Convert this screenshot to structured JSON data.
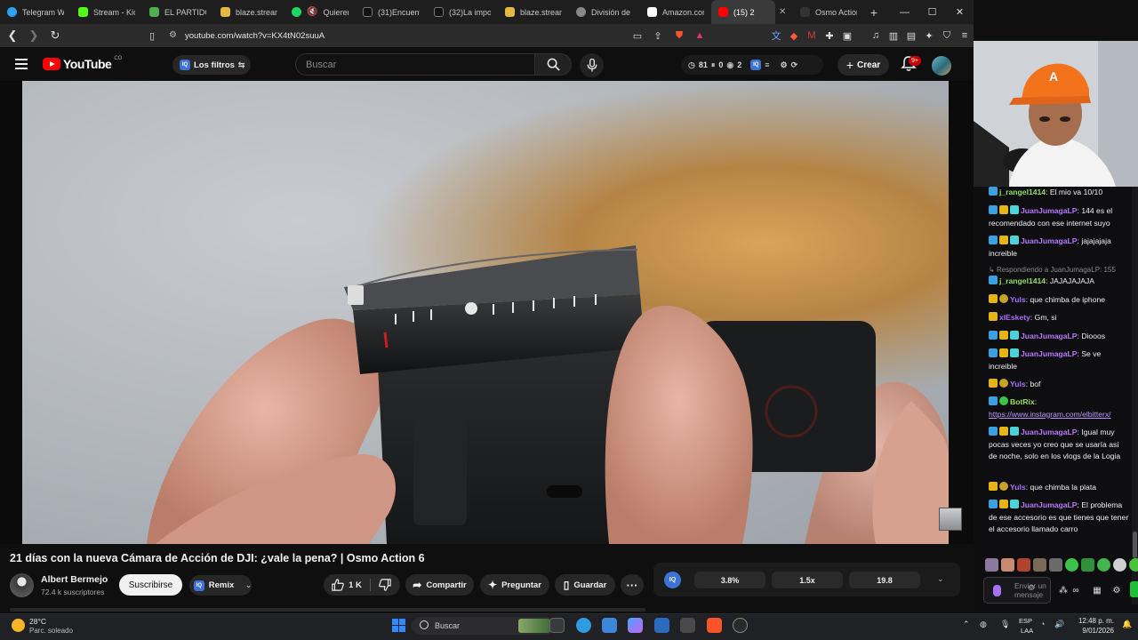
{
  "browser": {
    "tabs": [
      {
        "label": "Telegram We",
        "color": "#2aa3ef"
      },
      {
        "label": "Stream - Kick",
        "color": "#53fc18"
      },
      {
        "label": "EL PARTIDO",
        "color": "#4caf50"
      },
      {
        "label": "blaze.stream",
        "color": "#e5b93c"
      },
      {
        "label": "Quieren",
        "color": "#1ed760"
      },
      {
        "label": "(31)Encuent",
        "color": "#ffffff"
      },
      {
        "label": "(32)La impor",
        "color": "#ffffff"
      },
      {
        "label": "blaze.stream",
        "color": "#e5b93c"
      },
      {
        "label": "División de n",
        "color": "#cccccc"
      },
      {
        "label": "Amazon.com",
        "color": "#ffffff"
      },
      {
        "label": "(15) 2",
        "color": "#ff0000"
      },
      {
        "label": "Osmo Action",
        "color": "#333333"
      }
    ],
    "url": "youtube.com/watch?v=KX4tN02suuA"
  },
  "youtube": {
    "logo_text": "YouTube",
    "country_code": "CO",
    "filters_label": "Los filtros",
    "iq": "IQ",
    "search_placeholder": "Buscar",
    "stats": {
      "a": "81",
      "b": "0",
      "c": "2"
    },
    "create_label": "Crear",
    "notif_count": "9+"
  },
  "video": {
    "title": "21 días con la nueva Cámara de Acción de DJI: ¿vale la pena? | Osmo Action 6",
    "channel": "Albert Bermejo",
    "subscribers": "72.4 k suscriptores",
    "subscribe_label": "Suscribirse",
    "remix_label": "Remix",
    "likes": "1 K",
    "share_label": "Compartir",
    "ask_label": "Preguntar",
    "save_label": "Guardar",
    "more_label": "···"
  },
  "extension": {
    "logo": "IQ",
    "stats": [
      "3.8%",
      "1.5x",
      "19.8"
    ]
  },
  "chat": {
    "messages": [
      {
        "user": "j_rangel1414",
        "text": "El mio va 10/10"
      },
      {
        "user": "JuanJumagaLP",
        "text": "144 es el recomendado con ese internet suyo"
      },
      {
        "user": "JuanJumagaLP",
        "text": "jajajajaja increible"
      },
      {
        "reply": "Respondiendo a JuanJumagaLP: 155"
      },
      {
        "user": "j_rangel1414",
        "text": "JAJAJAJAJA"
      },
      {
        "user": "Yuls",
        "text": "que chimba de iphone"
      },
      {
        "user": "xIEskety",
        "text": "Gm, si"
      },
      {
        "user": "JuanJumagaLP",
        "text": "Diooos"
      },
      {
        "user": "JuanJumagaLP",
        "text": "Se ve increible"
      },
      {
        "user": "Yuls",
        "text": "bof"
      },
      {
        "user": "BotRix",
        "text": "https://www.instagram.com/elbitterx/"
      },
      {
        "user": "JuanJumagaLP",
        "text": "Igual muy pocas veces yo creo que se usaría así de noche, solo en los vlogs de la Logia"
      },
      {
        "user": "Yuls",
        "text": "que chimba la plata"
      },
      {
        "user": "JuanJumagaLP",
        "text": "El problema de ese accesorio es que tienes que tener el accesorio llamado carro"
      }
    ],
    "input_placeholder": "Enviar un mensaje"
  },
  "taskbar": {
    "temperature": "28°C",
    "weather": "Parc. soleado",
    "search_placeholder": "Buscar",
    "lang_1": "ESP",
    "lang_2": "LAA",
    "time": "12:48 p. m.",
    "date": "9/01/2026"
  }
}
